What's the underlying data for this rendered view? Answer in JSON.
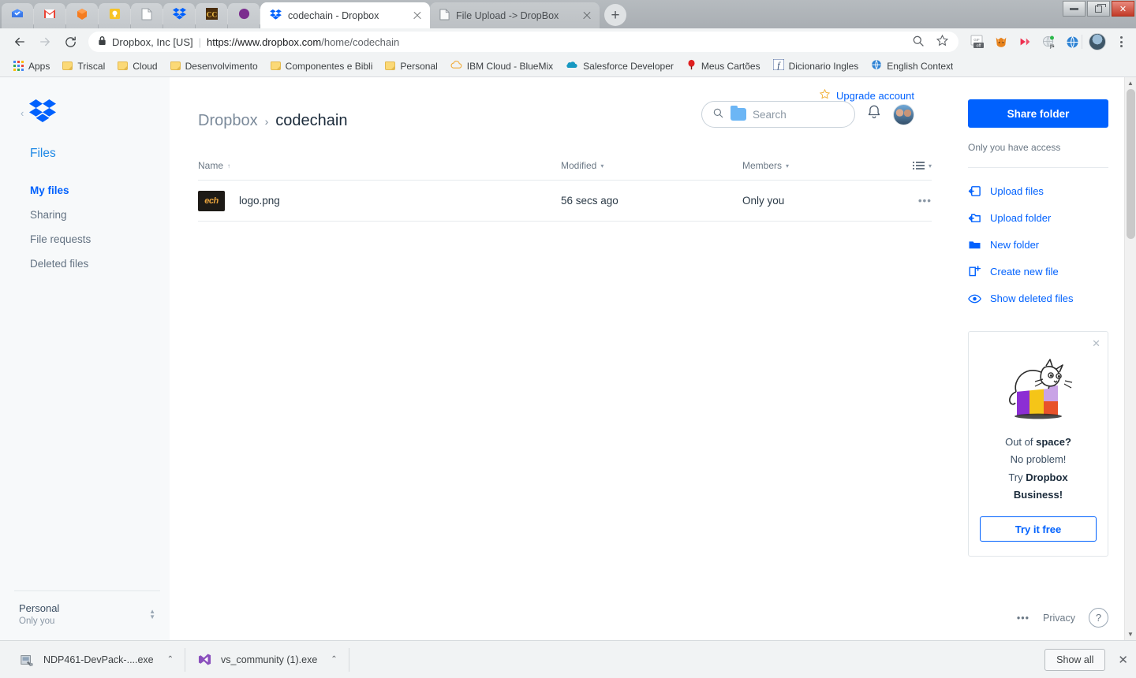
{
  "window": {
    "minimize_label": "Minimize",
    "restore_label": "Restore",
    "close_label": "Close"
  },
  "tabs": {
    "pinned": [
      {
        "name": "inbox-icon"
      },
      {
        "name": "gmail-icon"
      },
      {
        "name": "orange-cube-icon"
      },
      {
        "name": "keep-icon"
      },
      {
        "name": "document-icon"
      },
      {
        "name": "dropbox-icon"
      },
      {
        "name": "cc-icon"
      },
      {
        "name": "purple-circle-icon"
      }
    ],
    "open": [
      {
        "title": "codechain - Dropbox",
        "favicon": "dropbox-icon",
        "active": true
      },
      {
        "title": "File Upload -> DropBox",
        "favicon": "page-icon",
        "active": false
      }
    ],
    "new_tab_label": "+"
  },
  "toolbar": {
    "back_label": "Back",
    "forward_label": "Forward",
    "reload_label": "Reload",
    "site_identity": "Dropbox, Inc [US]",
    "url_host": "https://www.dropbox.com",
    "url_path": "/home/codechain",
    "separator": "|",
    "extensions": [
      {
        "name": "gif-off-extension",
        "label": "off"
      },
      {
        "name": "fox-extension"
      },
      {
        "name": "video-downloader-extension"
      },
      {
        "name": "javascript-extension",
        "label": "js"
      },
      {
        "name": "web-globe-extension"
      }
    ]
  },
  "bookmarks": [
    {
      "label": "Apps",
      "icon": "apps-grid-icon"
    },
    {
      "label": "Triscal",
      "icon": "folder-icon"
    },
    {
      "label": "Cloud",
      "icon": "folder-icon"
    },
    {
      "label": "Desenvolvimento",
      "icon": "folder-icon"
    },
    {
      "label": "Componentes e Bibli",
      "icon": "folder-icon"
    },
    {
      "label": "Personal",
      "icon": "folder-icon"
    },
    {
      "label": "IBM Cloud - BlueMix",
      "icon": "cloud-icon"
    },
    {
      "label": "Salesforce Developer",
      "icon": "salesforce-icon"
    },
    {
      "label": "Meus Cartões",
      "icon": "red-pin-icon"
    },
    {
      "label": "Dicionario Ingles",
      "icon": "dictionary-icon"
    },
    {
      "label": "English Context",
      "icon": "globe-icon"
    }
  ],
  "sidebar": {
    "logo_name": "dropbox-logo",
    "collapse_label": "‹",
    "files_label": "Files",
    "items": [
      {
        "label": "My files",
        "active": true
      },
      {
        "label": "Sharing",
        "active": false
      },
      {
        "label": "File requests",
        "active": false
      },
      {
        "label": "Deleted files",
        "active": false
      }
    ],
    "account": {
      "name": "Personal",
      "sub": "Only you"
    }
  },
  "header": {
    "upgrade_label": "Upgrade account",
    "breadcrumb_root": "Dropbox",
    "breadcrumb_separator": "›",
    "breadcrumb_current": "codechain",
    "search_placeholder": "Search"
  },
  "table": {
    "columns": {
      "name": "Name",
      "modified": "Modified",
      "members": "Members"
    },
    "sort_indicator": "↑",
    "caret": "▾",
    "rows": [
      {
        "name": "logo.png",
        "modified": "56 secs ago",
        "members": "Only you",
        "thumbnail_text": "ech",
        "more_label": "•••"
      }
    ]
  },
  "right_panel": {
    "share_button": "Share folder",
    "access_note": "Only you have access",
    "actions": [
      {
        "label": "Upload files",
        "icon": "upload-file-icon"
      },
      {
        "label": "Upload folder",
        "icon": "upload-folder-icon"
      },
      {
        "label": "New folder",
        "icon": "new-folder-icon"
      },
      {
        "label": "Create new file",
        "icon": "create-file-icon"
      },
      {
        "label": "Show deleted files",
        "icon": "eye-icon"
      }
    ],
    "promo": {
      "close_label": "✕",
      "line1_plain": "Out of ",
      "line1_bold": "space?",
      "line2": "No problem!",
      "line3_plain": "Try ",
      "line3_bold": "Dropbox",
      "line4_bold": "Business!",
      "cta": "Try it free"
    },
    "footer": {
      "more": "•••",
      "privacy": "Privacy",
      "help": "?"
    }
  },
  "downloads": [
    {
      "filename": "NDP461-DevPack-....exe",
      "icon": "installer-icon",
      "chevron": "⌃"
    },
    {
      "filename": "vs_community (1).exe",
      "icon": "visual-studio-icon",
      "chevron": "⌃"
    }
  ],
  "downloads_bar": {
    "show_all": "Show all",
    "close": "✕"
  },
  "colors": {
    "dropbox_blue": "#0061fe",
    "link_blue": "#1e88e5",
    "chrome_gray": "#f1f3f4"
  }
}
